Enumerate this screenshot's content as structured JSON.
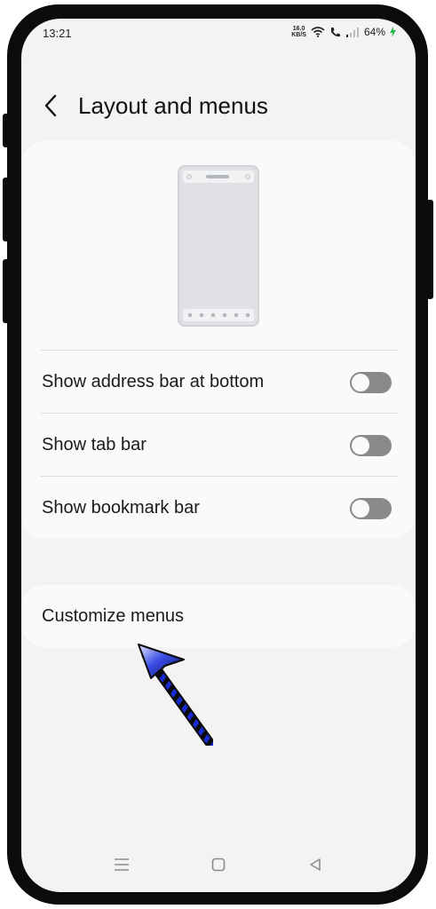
{
  "status_bar": {
    "time": "13:21",
    "net_speed_value": "16.0",
    "net_speed_unit": "KB/S",
    "battery": "64%",
    "icons": [
      "wifi-icon",
      "call-icon",
      "signal-icon",
      "charging-icon"
    ]
  },
  "header": {
    "title": "Layout and menus",
    "back_icon": "chevron-left-icon"
  },
  "settings": {
    "preview_icon": "phone-layout-preview-icon",
    "items": [
      {
        "label": "Show address bar at bottom",
        "enabled": false
      },
      {
        "label": "Show tab bar",
        "enabled": false
      },
      {
        "label": "Show bookmark bar",
        "enabled": false
      }
    ]
  },
  "customize": {
    "label": "Customize menus"
  },
  "navbar": {
    "buttons": [
      "recents-icon",
      "home-icon",
      "back-icon"
    ]
  },
  "colors": {
    "screen_bg": "#f3f3f3",
    "card_bg": "#fafafa",
    "toggle_off": "#8a8a8a",
    "arrow_blue": "#1a2bd6"
  }
}
